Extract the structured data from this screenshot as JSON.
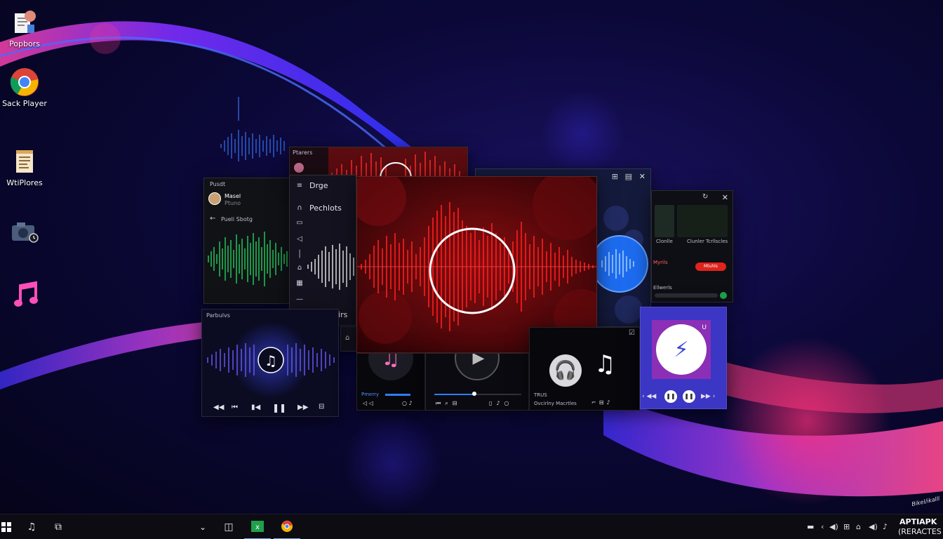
{
  "desktop": {
    "icons": [
      {
        "label": "Popbors",
        "icon": "document-folder-icon"
      },
      {
        "label": "Sack Player",
        "icon": "chrome-icon"
      },
      {
        "label": "WtiPlores",
        "icon": "notepad-icon"
      },
      {
        "label": "",
        "icon": "camera-folder-icon"
      },
      {
        "label": "",
        "icon": "music-note-icon"
      }
    ]
  },
  "windows": {
    "top_red": {
      "title": "Ptarers"
    },
    "green": {
      "title": "Pusdt",
      "user": "Masel",
      "sub": "Ptuno",
      "nav": "Pueli Sbotg"
    },
    "menu": {
      "title": "Ptarers",
      "items": [
        "Drge",
        "Pechlots",
        "",
        "",
        "",
        "",
        "",
        "Pulle Stirs"
      ]
    },
    "purple": {
      "title": "Parbulvs"
    },
    "blue_right": {},
    "far_right": {
      "item1": "Clonlle",
      "item2": "Clunler Tcrllscles",
      "label1": "Myrils",
      "label2": "Ellwerls",
      "button": "Mtuhls"
    },
    "bottom_a": {
      "label": "Pmerry"
    },
    "bottom_c": {
      "line1": "TRUS",
      "line2": "Ovcirlny Macrtles"
    }
  },
  "taskbar": {
    "clock": "APTIAPK",
    "subtext": "(RERACTES"
  },
  "colors": {
    "accent_red": "#e0231c",
    "accent_blue": "#2d7dff",
    "accent_green": "#1fa04a",
    "accent_pink": "#ff4fb8",
    "accent_purple": "#5a3cff"
  }
}
